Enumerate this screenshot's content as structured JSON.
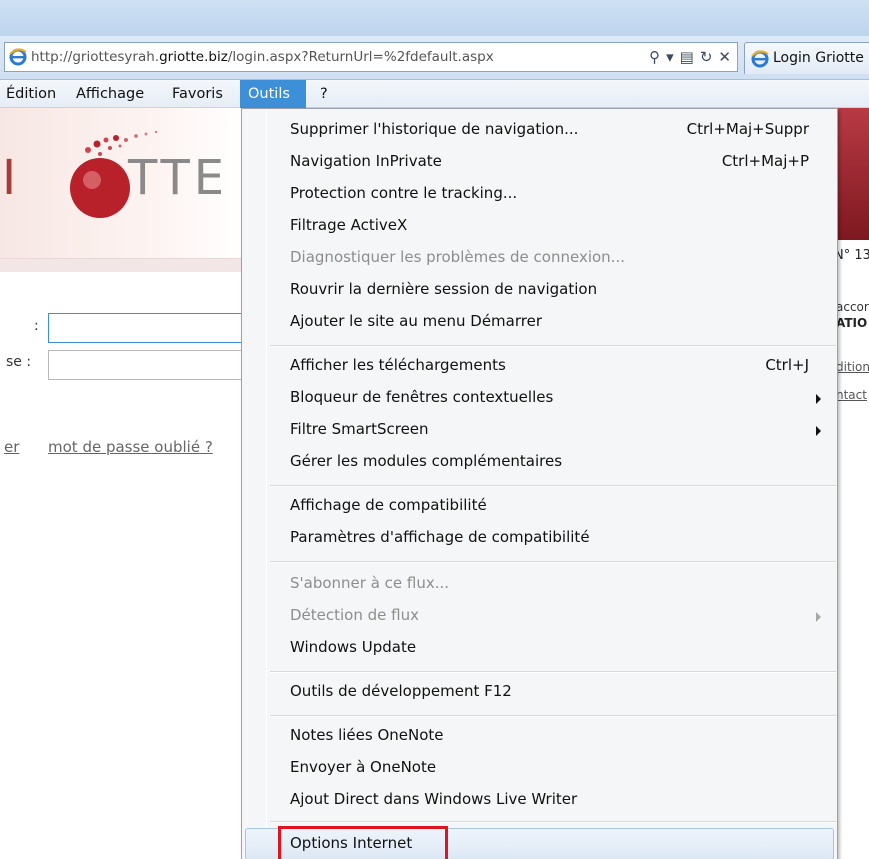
{
  "address_bar": {
    "url_prefix": "http://griottesyrah.",
    "url_domain": "griotte.biz",
    "url_suffix": "/login.aspx?ReturnUrl=%2fdefault.aspx",
    "tools": [
      "search-icon",
      "dropdown-arrow-icon",
      "compat-view-icon",
      "refresh-icon",
      "stop-icon"
    ]
  },
  "tab": {
    "title": "Login Griotte"
  },
  "menubar": {
    "items": [
      {
        "label": "Édition",
        "active": false
      },
      {
        "label": "Affichage",
        "active": false
      },
      {
        "label": "Favoris",
        "active": false
      },
      {
        "label": "Outils",
        "active": true
      },
      {
        "label": "?",
        "active": false
      }
    ]
  },
  "page": {
    "logo_initial": "I",
    "logo_word": "TTE",
    "strip_number": "N° 13",
    "field_labels": [
      ":",
      "se :"
    ],
    "links": [
      "er",
      "mot de passe oublié ?"
    ],
    "side_texts": [
      "accord",
      "ATIO",
      "ditions",
      "ntact"
    ]
  },
  "tools_menu": {
    "items": [
      {
        "label": "Supprimer l'historique de navigation...",
        "shortcut": "Ctrl+Maj+Suppr"
      },
      {
        "label": "Navigation InPrivate",
        "shortcut": "Ctrl+Maj+P"
      },
      {
        "label": "Protection contre le tracking..."
      },
      {
        "label": "Filtrage ActiveX"
      },
      {
        "label": "Diagnostiquer les problèmes de connexion...",
        "disabled": true
      },
      {
        "label": "Rouvrir la dernière session de navigation"
      },
      {
        "label": "Ajouter le site au menu Démarrer"
      },
      {
        "label": "Afficher les téléchargements",
        "shortcut": "Ctrl+J"
      },
      {
        "label": "Bloqueur de fenêtres contextuelles",
        "submenu": true
      },
      {
        "label": "Filtre SmartScreen",
        "submenu": true
      },
      {
        "label": "Gérer les modules complémentaires"
      },
      {
        "label": "Affichage de compatibilité"
      },
      {
        "label": "Paramètres d'affichage de compatibilité"
      },
      {
        "label": "S'abonner à ce flux...",
        "disabled": true
      },
      {
        "label": "Détection de flux",
        "disabled": true,
        "submenu": true
      },
      {
        "label": "Windows Update"
      },
      {
        "label": "Outils de développement F12"
      },
      {
        "label": "Notes liées OneNote"
      },
      {
        "label": "Envoyer à OneNote"
      },
      {
        "label": "Ajout Direct dans Windows Live Writer"
      },
      {
        "label": "Options Internet",
        "highlighted": true
      }
    ]
  },
  "colors": {
    "menu_active": "#3d8fd8",
    "highlight_box": "#e0141f",
    "logo_red": "#b8202a"
  }
}
